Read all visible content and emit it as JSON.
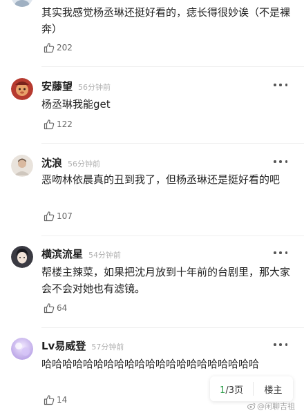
{
  "comments": [
    {
      "text": "其实我感觉杨丞琳还挺好看的，痣长得很妙诶（不是裸奔）",
      "likes": "202"
    },
    {
      "name": "安藤望",
      "time": "56分钟前",
      "text": "杨丞琳我能get",
      "likes": "122"
    },
    {
      "name": "沈浪",
      "time": "56分钟前",
      "text": "恶吻林依晨真的丑到我了，但杨丞琳还是挺好看的吧",
      "likes": "107"
    },
    {
      "name": "横滨流星",
      "time": "54分钟前",
      "text": "帮楼主辣菜，如果把沈月放到十年前的台剧里，那大家会不会对她也有滤镜。",
      "likes": "64"
    },
    {
      "name": "Lv易威登",
      "time": "57分钟前",
      "text": "哈哈哈哈哈哈哈哈哈哈哈哈哈哈哈哈哈哈哈哈哈",
      "likes": "14"
    }
  ],
  "pager": {
    "current": "1",
    "total": "/3页",
    "owner_label": "楼主"
  },
  "watermark": "@闲聊吉祖",
  "colors": {
    "accent": "#2e9e4a",
    "meta_gray": "#b0b0b0"
  }
}
